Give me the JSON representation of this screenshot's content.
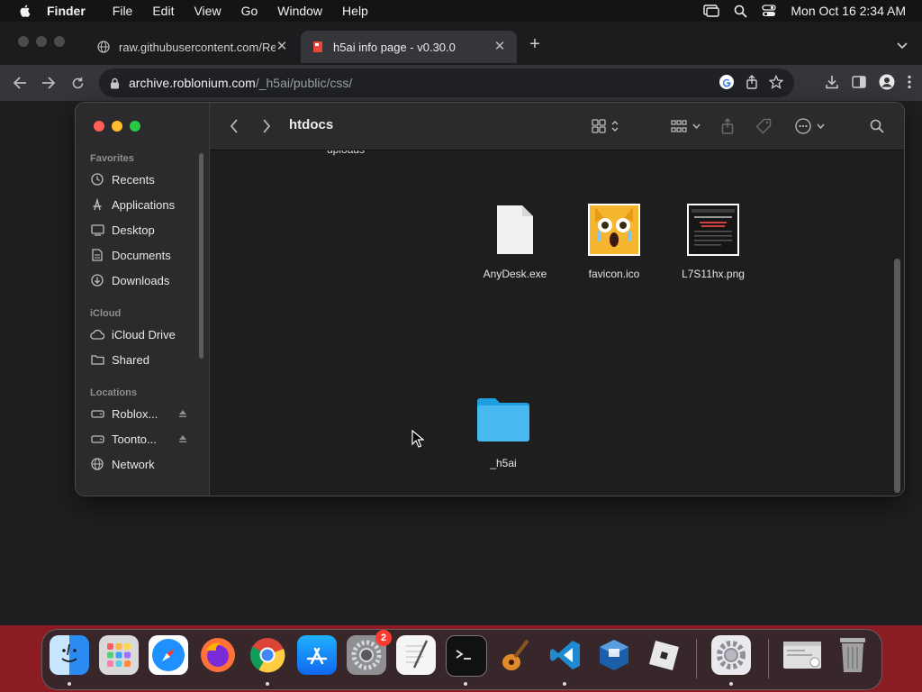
{
  "menubar": {
    "app_name": "Finder",
    "items": [
      "File",
      "Edit",
      "View",
      "Go",
      "Window",
      "Help"
    ],
    "clock": "Mon Oct 16  2:34 AM"
  },
  "browser": {
    "tabs": [
      {
        "title": "raw.githubusercontent.com/Re",
        "icon": "globe-icon",
        "active": false
      },
      {
        "title": "h5ai info page - v0.30.0",
        "icon": "h5ai-favicon-icon",
        "active": true
      }
    ],
    "address": {
      "host": "archive.roblonium.com",
      "path": "/_h5ai/public/css/"
    }
  },
  "finder": {
    "title": "htdocs",
    "sidebar": {
      "favorites_label": "Favorites",
      "favorites": [
        {
          "label": "Recents",
          "icon": "clock-icon"
        },
        {
          "label": "Applications",
          "icon": "applications-icon"
        },
        {
          "label": "Desktop",
          "icon": "desktop-icon"
        },
        {
          "label": "Documents",
          "icon": "document-icon"
        },
        {
          "label": "Downloads",
          "icon": "download-icon"
        }
      ],
      "icloud_label": "iCloud",
      "icloud": [
        {
          "label": "iCloud Drive",
          "icon": "cloud-icon"
        },
        {
          "label": "Shared",
          "icon": "shared-folder-icon"
        }
      ],
      "locations_label": "Locations",
      "locations": [
        {
          "label": "Roblox...",
          "icon": "drive-icon"
        },
        {
          "label": "Toonto...",
          "icon": "drive-icon"
        },
        {
          "label": "Network",
          "icon": "network-icon"
        }
      ]
    },
    "partial_item": "uploads",
    "files": [
      {
        "name": "AnyDesk.exe",
        "icon": "generic-file-icon"
      },
      {
        "name": "favicon.ico",
        "icon": "favicon-image-icon"
      },
      {
        "name": "L7S11hx.png",
        "icon": "screenshot-image-icon"
      },
      {
        "name": "_h5ai",
        "icon": "folder-icon"
      }
    ]
  },
  "dock": {
    "apps": [
      {
        "name": "Finder",
        "icon": "finder-icon",
        "color": "#2a8bf2"
      },
      {
        "name": "Launchpad",
        "icon": "launchpad-icon",
        "color": "#d9d9d9"
      },
      {
        "name": "Safari",
        "icon": "safari-icon",
        "color": "#1e90ff"
      },
      {
        "name": "Firefox",
        "icon": "firefox-icon",
        "color": "#ff7139"
      },
      {
        "name": "Chrome",
        "icon": "chrome-icon",
        "color": "#ffffff"
      },
      {
        "name": "App Store",
        "icon": "app-store-icon",
        "color": "#1c8ef9"
      },
      {
        "name": "System Settings",
        "icon": "system-settings-icon",
        "color": "#8e8e93",
        "badge": "2"
      },
      {
        "name": "TextEdit",
        "icon": "textedit-icon",
        "color": "#f5f5f5"
      },
      {
        "name": "Terminal",
        "icon": "terminal-icon",
        "color": "#111111"
      },
      {
        "name": "GarageBand",
        "icon": "garageband-icon",
        "color": "#e08a2a"
      },
      {
        "name": "Visual Studio Code",
        "icon": "vscode-icon",
        "color": "#1f8ad2"
      },
      {
        "name": "VirtualBox",
        "icon": "virtualbox-icon",
        "color": "#1b5fa8"
      },
      {
        "name": "Roblox",
        "icon": "roblox-icon",
        "color": "#e8e8e8"
      },
      {
        "name": "Settings",
        "icon": "gear-app-icon",
        "color": "#c9c9cf"
      },
      {
        "name": "Preview",
        "icon": "preview-icon",
        "color": "#e0e0e0"
      },
      {
        "name": "Trash",
        "icon": "trash-icon",
        "color": "#9a9a9a"
      }
    ]
  }
}
